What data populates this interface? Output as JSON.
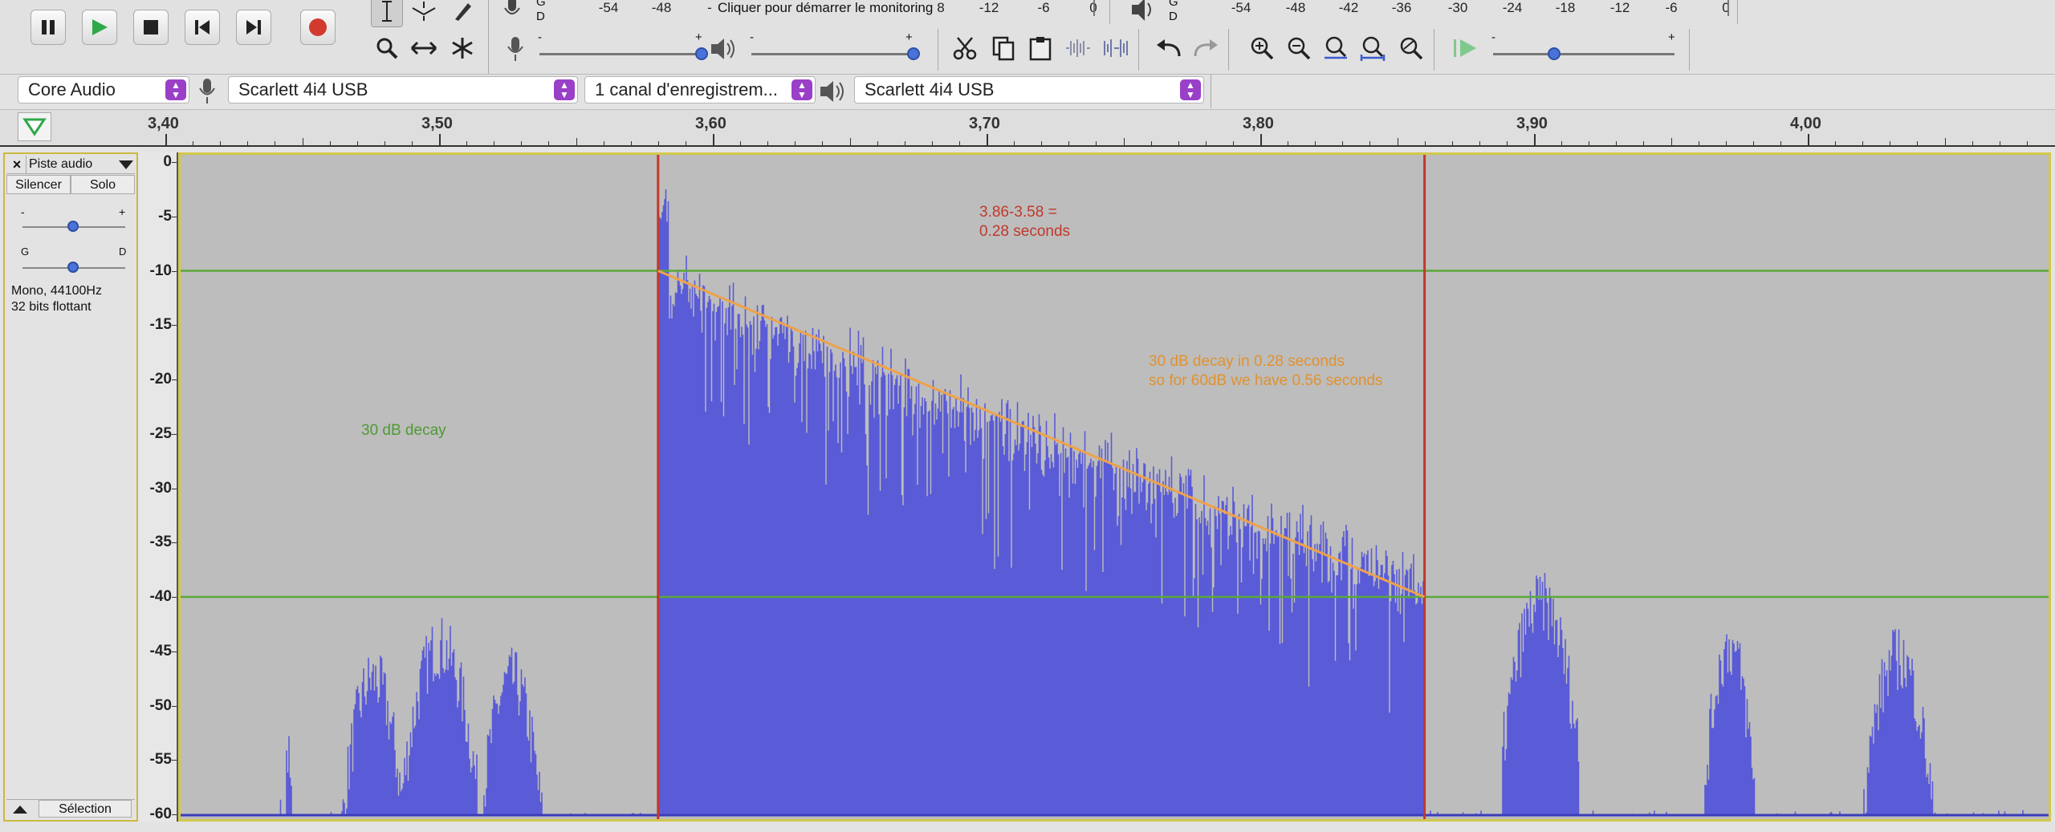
{
  "transport": {
    "pause": "pause",
    "play": "play",
    "stop": "stop",
    "skip_start": "skip-to-start",
    "skip_end": "skip-to-end",
    "record": "record"
  },
  "record_meter": {
    "channel_top": "G",
    "channel_bottom": "D",
    "ticks": [
      "-54",
      "-48",
      "-",
      "8",
      "-12",
      "-6",
      "0"
    ],
    "prompt": "Cliquer pour démarrer le monitoring"
  },
  "play_meter": {
    "channel_top": "G",
    "channel_bottom": "D",
    "ticks": [
      "-54",
      "-48",
      "-42",
      "-36",
      "-30",
      "-24",
      "-18",
      "-12",
      "-6",
      "0"
    ]
  },
  "sliders": {
    "rec_volume_minus": "-",
    "rec_volume_plus": "+",
    "play_volume_minus": "-",
    "play_volume_plus": "+",
    "speed_minus": "-",
    "speed_plus": "+"
  },
  "devices": {
    "host": "Core Audio",
    "recording_device": "Scarlett 4i4 USB",
    "channels": "1 canal d'enregistrem...",
    "playback_device": "Scarlett 4i4 USB"
  },
  "timeline": {
    "labels": [
      "3,40",
      "3,50",
      "3,60",
      "3,70",
      "3,80",
      "3,90",
      "4,00"
    ]
  },
  "track": {
    "name": "Piste audio",
    "close": "×",
    "mute": "Silencer",
    "solo": "Solo",
    "gain_minus": "-",
    "gain_plus": "+",
    "pan_left": "G",
    "pan_right": "D",
    "info_line1": "Mono, 44100Hz",
    "info_line2": "32 bits flottant",
    "select": "Sélection"
  },
  "db_scale": [
    "0",
    "-5",
    "-10",
    "-15",
    "-20",
    "-25",
    "-30",
    "-35",
    "-40",
    "-45",
    "-50",
    "-55",
    "-60"
  ],
  "annotations": {
    "time_line1": "3.86-3.58 =",
    "time_line2": "0.28 seconds",
    "decay_line1": "30 dB decay in 0.28 seconds",
    "decay_line2": "so for 60dB we have 0.56 seconds",
    "green_label": "30 dB decay"
  },
  "markers": {
    "start_time": 3.58,
    "end_time": 3.86,
    "level_high_db": -10,
    "level_low_db": -40
  },
  "colors": {
    "waveform": "#5a5bd6",
    "waveform_edge": "#3b3cb8",
    "red_marker": "#c0392b",
    "green_line": "#5aa83a",
    "orange_line": "#eea24a",
    "combo_arrow": "#9a3fc7"
  }
}
